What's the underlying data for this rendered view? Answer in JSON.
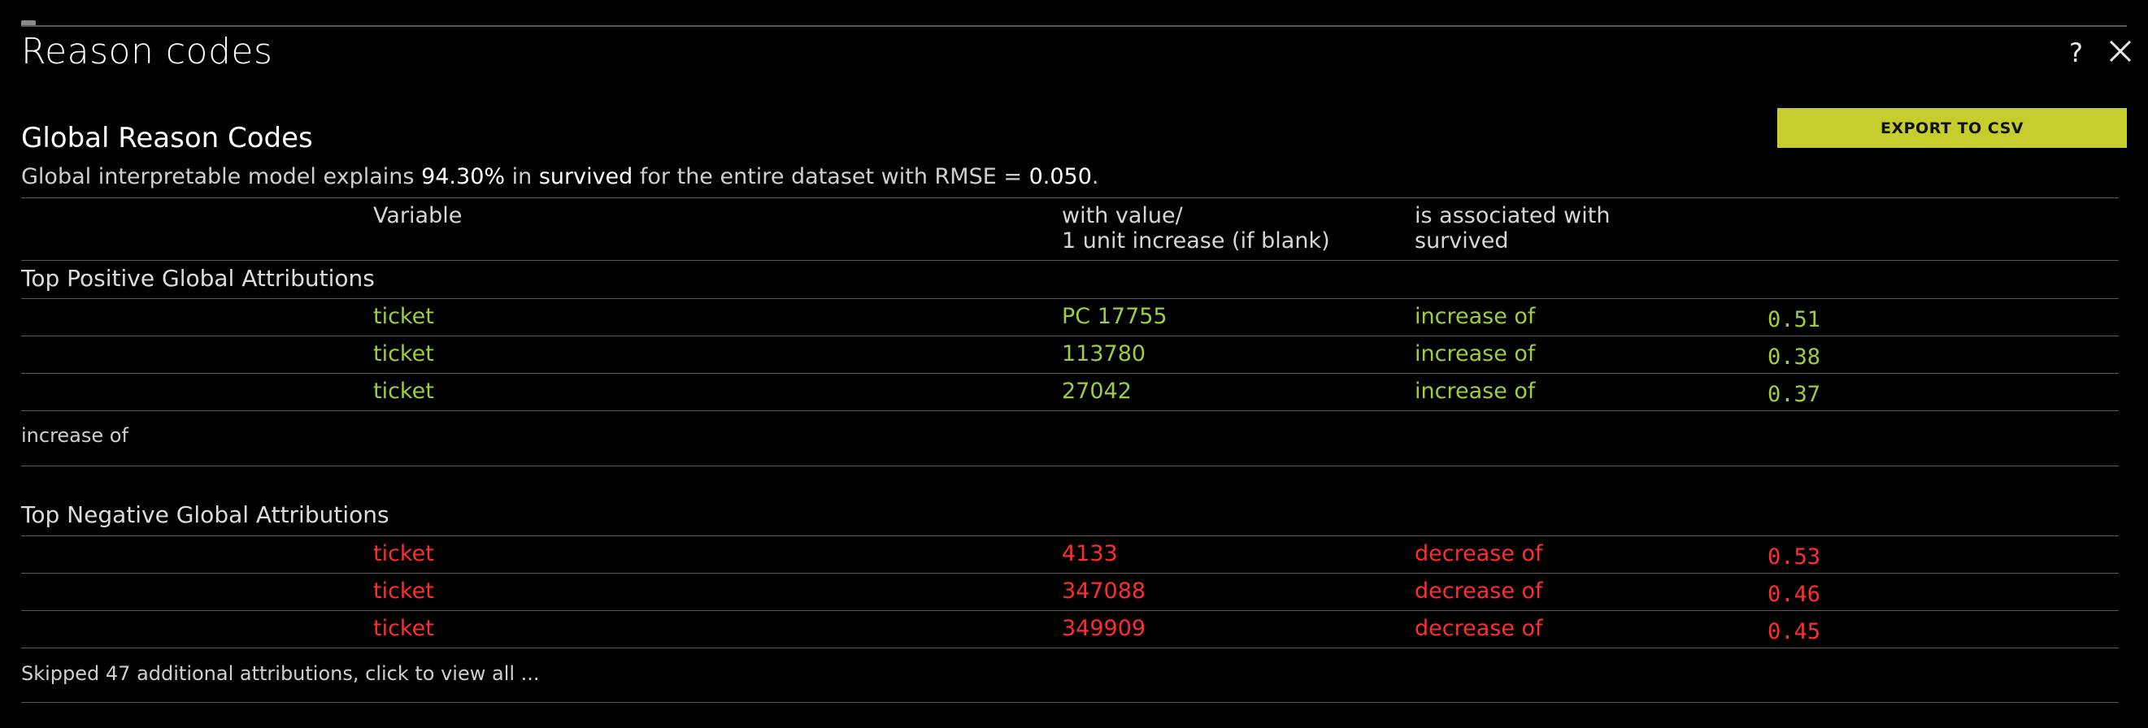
{
  "modal": {
    "title": "Reason codes",
    "help_label": "?",
    "export_label": "EXPORT TO CSV"
  },
  "section": {
    "title": "Global Reason Codes",
    "summary_prefix": "Global interpretable model explains ",
    "summary_pct": "94.30%",
    "summary_in": " in ",
    "summary_target": "survived",
    "summary_mid": " for the entire dataset with RMSE = ",
    "summary_rmse": "0.050",
    "summary_end": "."
  },
  "columns": {
    "variable": "Variable",
    "value_line1": "with value/",
    "value_line2": "1 unit increase (if blank)",
    "assoc_line1": "is associated with",
    "assoc_line2": "survived"
  },
  "positive": {
    "label": "Top Positive Global Attributions",
    "rows": [
      {
        "variable": "ticket",
        "value": "PC 17755",
        "assoc": "increase of",
        "amount": "0.51"
      },
      {
        "variable": "ticket",
        "value": "113780",
        "assoc": "increase of",
        "amount": "0.38"
      },
      {
        "variable": "ticket",
        "value": "27042",
        "assoc": "increase of",
        "amount": "0.37"
      }
    ],
    "note": "increase of"
  },
  "negative": {
    "label": "Top Negative Global Attributions",
    "rows": [
      {
        "variable": "ticket",
        "value": "4133",
        "assoc": "decrease of",
        "amount": "0.53"
      },
      {
        "variable": "ticket",
        "value": "347088",
        "assoc": "decrease of",
        "amount": "0.46"
      },
      {
        "variable": "ticket",
        "value": "349909",
        "assoc": "decrease of",
        "amount": "0.45"
      }
    ],
    "note": "Skipped 47 additional attributions, click to view all ..."
  },
  "colors": {
    "accent": "#c6ce2d",
    "positive": "#9ccd43",
    "negative": "#ff2d2d"
  }
}
